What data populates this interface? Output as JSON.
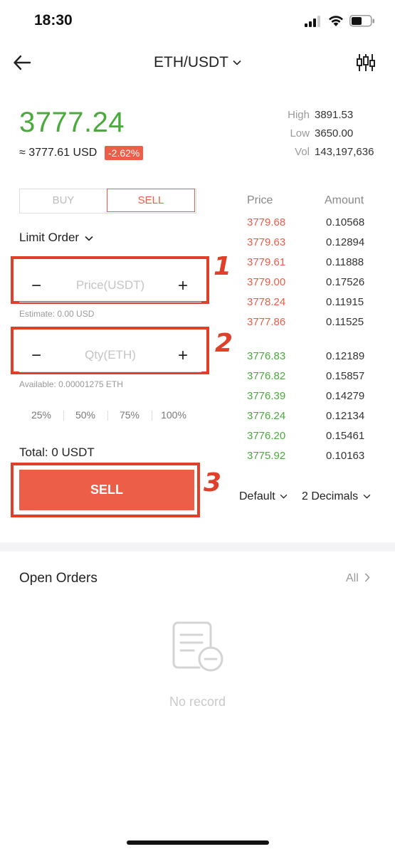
{
  "status": {
    "time": "18:30"
  },
  "header": {
    "pair": "ETH/USDT"
  },
  "ticker": {
    "last_price": "3777.24",
    "usd_equiv": "≈ 3777.61 USD",
    "change": "-2.62%",
    "high_label": "High",
    "high": "3891.53",
    "low_label": "Low",
    "low": "3650.00",
    "vol_label": "Vol",
    "vol": "143,197,636"
  },
  "trade": {
    "buy_tab": "BUY",
    "sell_tab": "SELL",
    "order_type": "Limit Order",
    "price_placeholder": "Price(USDT)",
    "estimate": "Estimate: 0.00 USD",
    "qty_placeholder": "Qty(ETH)",
    "available": "Available: 0.00001275 ETH",
    "percents": [
      "25%",
      "50%",
      "75%",
      "100%"
    ],
    "total": "Total: 0 USDT",
    "sell_button": "SELL"
  },
  "annotations": {
    "one": "1",
    "two": "2",
    "three": "3"
  },
  "orderbook": {
    "price_header": "Price",
    "amount_header": "Amount",
    "asks": [
      {
        "price": "3779.68",
        "amount": "0.10568"
      },
      {
        "price": "3779.63",
        "amount": "0.12894"
      },
      {
        "price": "3779.61",
        "amount": "0.11888"
      },
      {
        "price": "3779.00",
        "amount": "0.17526"
      },
      {
        "price": "3778.24",
        "amount": "0.11915"
      },
      {
        "price": "3777.86",
        "amount": "0.11525"
      }
    ],
    "bids": [
      {
        "price": "3776.83",
        "amount": "0.12189"
      },
      {
        "price": "3776.82",
        "amount": "0.15857"
      },
      {
        "price": "3776.39",
        "amount": "0.14279"
      },
      {
        "price": "3776.24",
        "amount": "0.12134"
      },
      {
        "price": "3776.20",
        "amount": "0.15461"
      },
      {
        "price": "3775.92",
        "amount": "0.10163"
      }
    ],
    "default_label": "Default",
    "decimals_label": "2 Decimals"
  },
  "open_orders": {
    "title": "Open Orders",
    "all": "All",
    "empty": "No record"
  },
  "colors": {
    "accent": "#ec5e48",
    "up": "#4aaa3c",
    "annotation": "#e0402a"
  }
}
